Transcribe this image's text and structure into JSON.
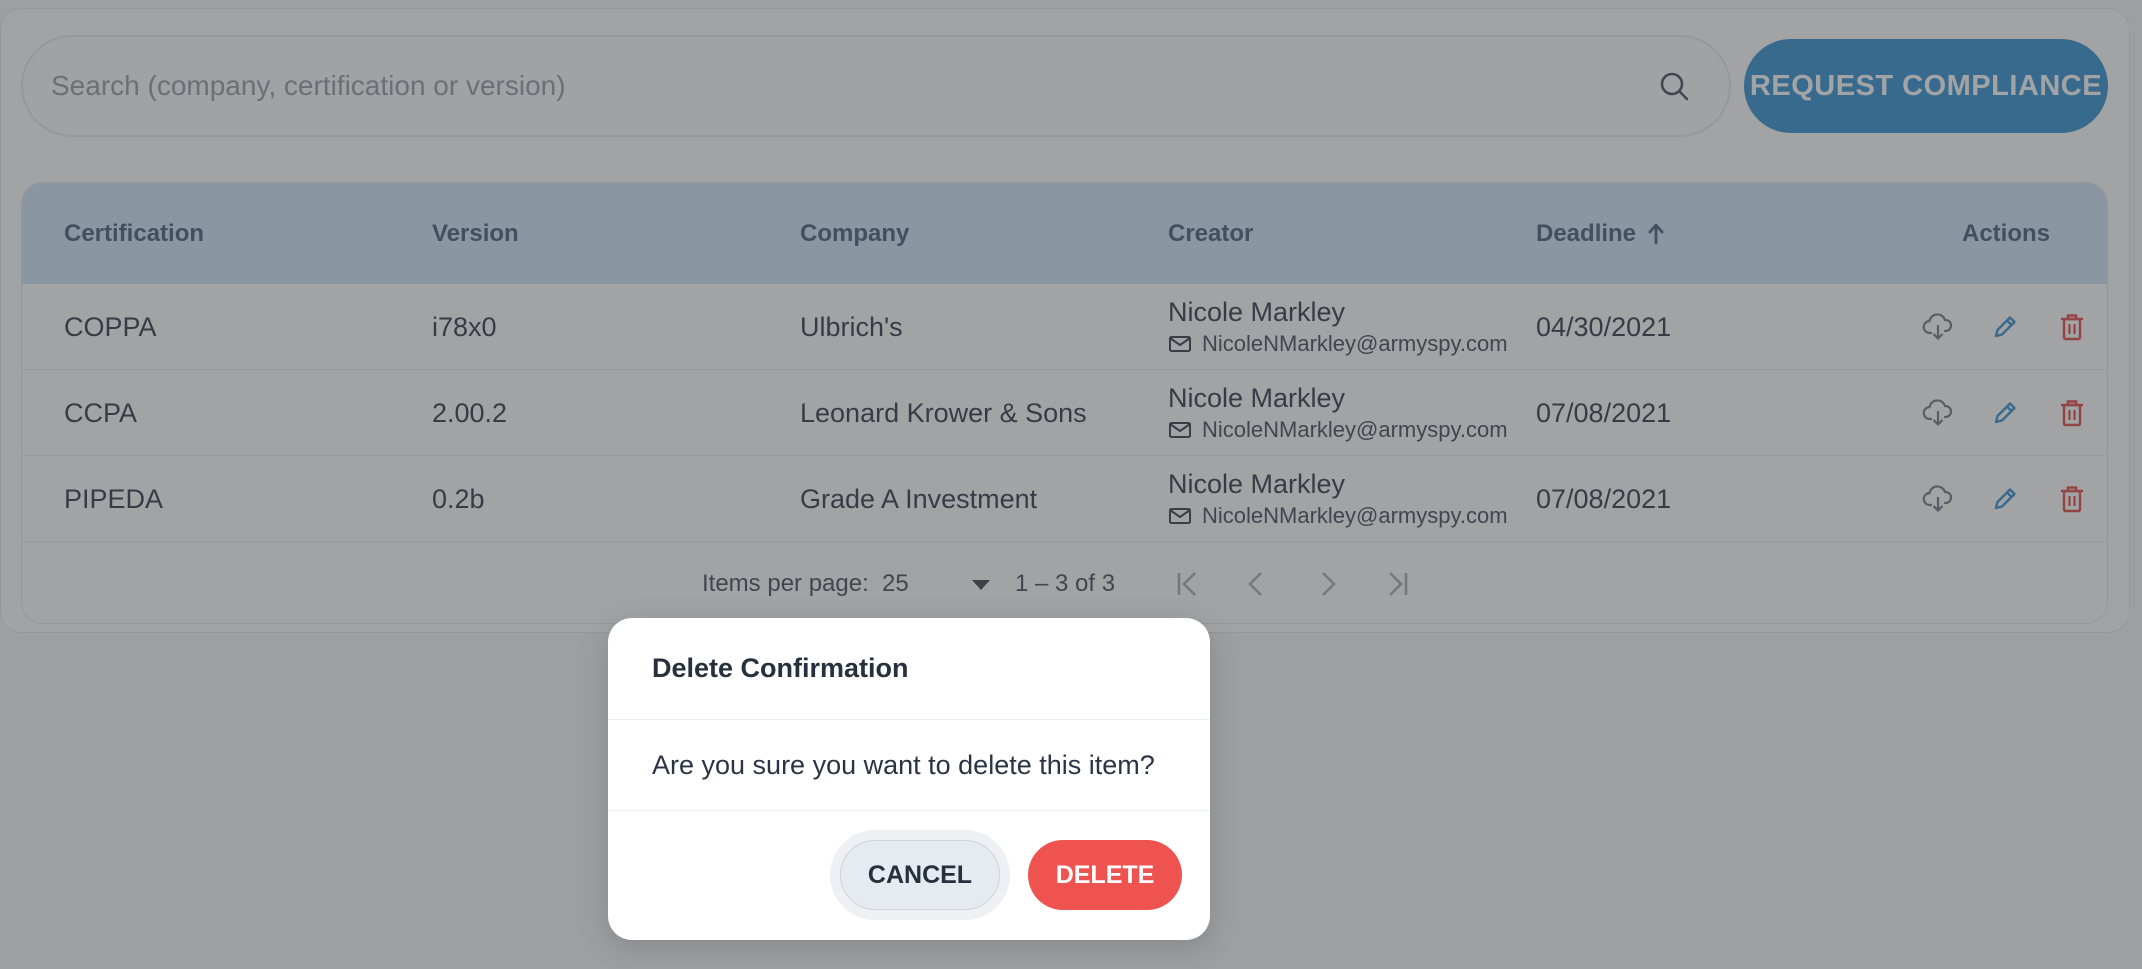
{
  "search": {
    "placeholder": "Search (company, certification or version)"
  },
  "request_button_label": "REQUEST COMPLIANCE",
  "table": {
    "headers": {
      "certification": "Certification",
      "version": "Version",
      "company": "Company",
      "creator": "Creator",
      "deadline": "Deadline",
      "actions": "Actions"
    },
    "sort": {
      "column": "Deadline",
      "direction": "ascending",
      "icon": "arrow-up-icon"
    },
    "rows": [
      {
        "certification": "COPPA",
        "version": "i78x0",
        "company": "Ulbrich's",
        "creator_name": "Nicole Markley",
        "creator_email": "NicoleNMarkley@armyspy.com",
        "deadline": "04/30/2021"
      },
      {
        "certification": "CCPA",
        "version": "2.00.2",
        "company": "Leonard Krower & Sons",
        "creator_name": "Nicole Markley",
        "creator_email": "NicoleNMarkley@armyspy.com",
        "deadline": "07/08/2021"
      },
      {
        "certification": "PIPEDA",
        "version": "0.2b",
        "company": "Grade A Investment",
        "creator_name": "Nicole Markley",
        "creator_email": "NicoleNMarkley@armyspy.com",
        "deadline": "07/08/2021"
      }
    ],
    "action_icons": [
      "cloud-download-icon",
      "pencil-edit-icon",
      "trash-delete-icon"
    ]
  },
  "pagination": {
    "items_per_page_label": "Items per page:",
    "items_per_page_value": "25",
    "range": "1 – 3 of 3"
  },
  "dialog": {
    "title": "Delete Confirmation",
    "message": "Are you sure you want to delete this item?",
    "cancel_label": "CANCEL",
    "delete_label": "DELETE"
  },
  "colors": {
    "primary": "#2b8cd0",
    "header_bg": "#cfe4f7",
    "danger": "#ef5350",
    "edit_icon": "#2b8cd0",
    "overlay": "rgba(70,72,76,0.5)"
  }
}
